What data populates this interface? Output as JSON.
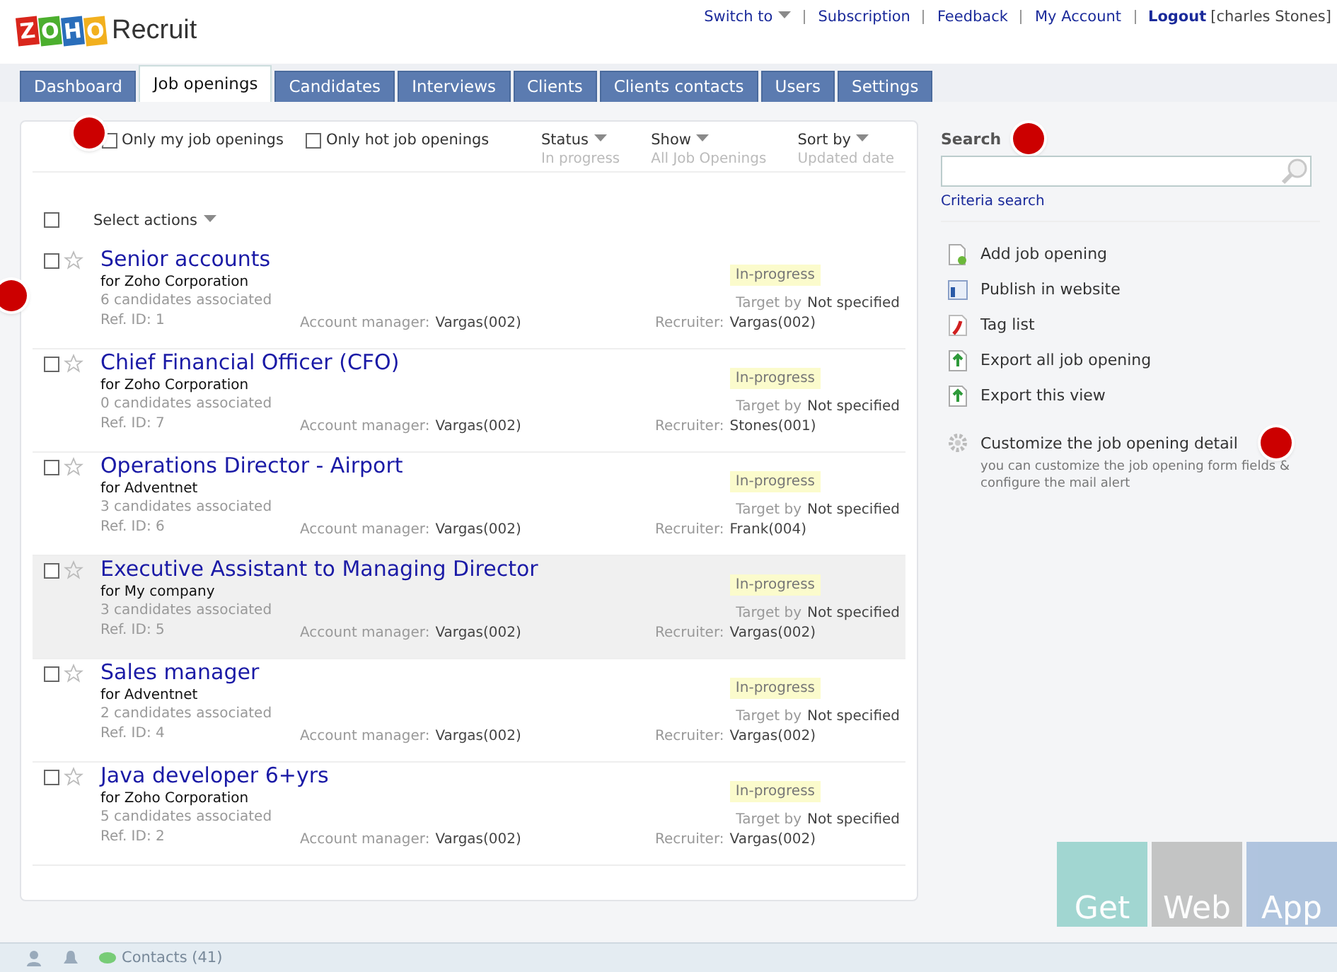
{
  "header": {
    "logo_letters": [
      "Z",
      "O",
      "H",
      "O"
    ],
    "product": "Recruit",
    "links": [
      {
        "label": "Switch to",
        "dropdown": true
      },
      {
        "label": "Subscription",
        "dropdown": false
      },
      {
        "label": "Feedback",
        "dropdown": false
      },
      {
        "label": "My Account",
        "dropdown": false
      }
    ],
    "logout": "Logout",
    "user": "[charles Stones]"
  },
  "tabs": [
    {
      "label": "Dashboard",
      "selected": false
    },
    {
      "label": "Job openings",
      "selected": true
    },
    {
      "label": "Candidates",
      "selected": false
    },
    {
      "label": "Interviews",
      "selected": false
    },
    {
      "label": "Clients",
      "selected": false
    },
    {
      "label": "Clients contacts",
      "selected": false
    },
    {
      "label": "Users",
      "selected": false
    },
    {
      "label": "Settings",
      "selected": false
    }
  ],
  "filters": {
    "marker": true,
    "checks": [
      {
        "label": "Only my job openings",
        "checked": false
      },
      {
        "label": "Only hot job openings",
        "checked": false
      }
    ],
    "dropdowns": [
      {
        "label": "Status",
        "value": "In progress"
      },
      {
        "label": "Show",
        "value": "All Job Openings"
      },
      {
        "label": "Sort by",
        "value": "Updated date"
      }
    ]
  },
  "select_all": {
    "checked": false,
    "label": "Select actions"
  },
  "jobs": [
    {
      "title": "Senior accounts",
      "client": "for Zoho Corporation",
      "candidates": "6 candidates associated",
      "ref": "Ref. ID: 1",
      "manager_label": "Account manager:",
      "manager": "Vargas(002)",
      "recruiter_label": "Recruiter:",
      "recruiter": "Vargas(002)",
      "status": "In-progress",
      "target_label": "Target by",
      "target": "Not specified",
      "checked": false,
      "starred": false,
      "highlighted": false,
      "marker": true
    },
    {
      "title": "Chief Financial Officer (CFO)",
      "client": "for Zoho Corporation",
      "candidates": "0 candidates associated",
      "ref": "Ref. ID: 7",
      "manager_label": "Account manager:",
      "manager": "Vargas(002)",
      "recruiter_label": "Recruiter:",
      "recruiter": "Stones(001)",
      "status": "In-progress",
      "target_label": "Target by",
      "target": "Not specified",
      "checked": false,
      "starred": false,
      "highlighted": false,
      "marker": false
    },
    {
      "title": "Operations Director - Airport",
      "client": "for Adventnet",
      "candidates": "3 candidates associated",
      "ref": "Ref. ID: 6",
      "manager_label": "Account manager:",
      "manager": "Vargas(002)",
      "recruiter_label": "Recruiter:",
      "recruiter": "Frank(004)",
      "status": "In-progress",
      "target_label": "Target by",
      "target": "Not specified",
      "checked": false,
      "starred": false,
      "highlighted": false,
      "marker": false
    },
    {
      "title": "Executive Assistant to Managing Director",
      "client": "for My company",
      "candidates": "3 candidates associated",
      "ref": "Ref. ID: 5",
      "manager_label": "Account manager:",
      "manager": "Vargas(002)",
      "recruiter_label": "Recruiter:",
      "recruiter": "Vargas(002)",
      "status": "In-progress",
      "target_label": "Target by",
      "target": "Not specified",
      "checked": false,
      "starred": false,
      "highlighted": true,
      "marker": false
    },
    {
      "title": "Sales manager",
      "client": "for Adventnet",
      "candidates": "2 candidates associated",
      "ref": "Ref. ID: 4",
      "manager_label": "Account manager:",
      "manager": "Vargas(002)",
      "recruiter_label": "Recruiter:",
      "recruiter": "Vargas(002)",
      "status": "In-progress",
      "target_label": "Target by",
      "target": "Not specified",
      "checked": false,
      "starred": false,
      "highlighted": false,
      "marker": false
    },
    {
      "title": "Java developer 6+yrs",
      "client": "for Zoho Corporation",
      "candidates": "5 candidates associated",
      "ref": "Ref. ID: 2",
      "manager_label": "Account manager:",
      "manager": "Vargas(002)",
      "recruiter_label": "Recruiter:",
      "recruiter": "Vargas(002)",
      "status": "In-progress",
      "target_label": "Target by",
      "target": "Not specified",
      "checked": false,
      "starred": false,
      "highlighted": false,
      "marker": false
    }
  ],
  "search": {
    "label": "Search",
    "marker": true,
    "link": "Criteria search"
  },
  "actions": [
    {
      "kind": "add",
      "label": "Add job opening"
    },
    {
      "kind": "publish",
      "label": "Publish in website"
    },
    {
      "kind": "tag",
      "label": "Tag list"
    },
    {
      "kind": "export",
      "label": "Export all job opening"
    },
    {
      "kind": "export",
      "label": "Export this view"
    }
  ],
  "customize": {
    "label": "Customize the job opening detail",
    "hint": "you can customize the job opening form fields & configure the mail alert",
    "marker": true
  },
  "app_tiles": [
    "Get",
    "Web",
    "App"
  ],
  "footer": {
    "contacts": "Contacts (41)"
  }
}
